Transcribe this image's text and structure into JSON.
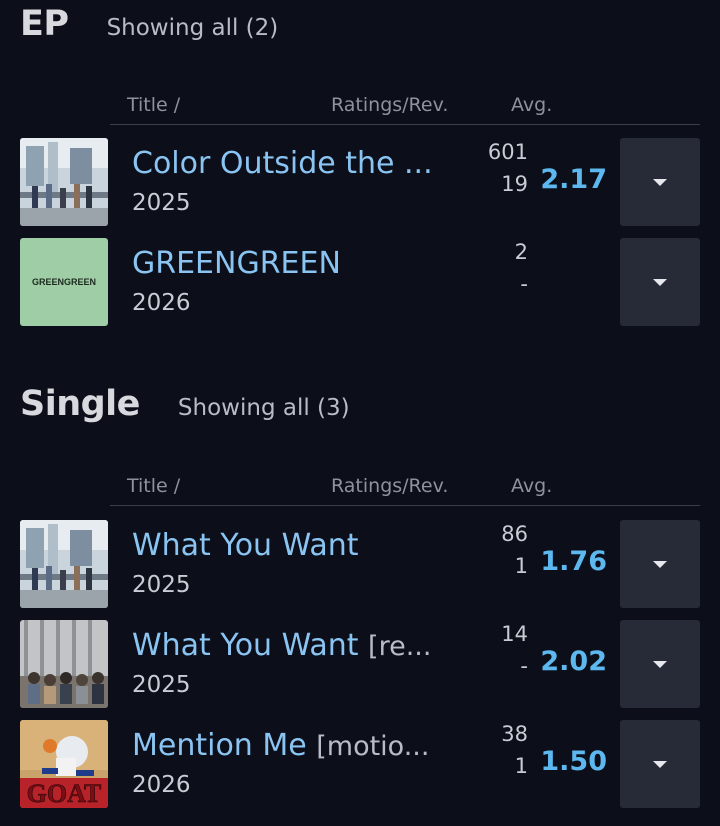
{
  "sections": [
    {
      "title": "EP",
      "count": "Showing all (2)",
      "columns": {
        "title": "Title /",
        "ratings": "Ratings/Rev.",
        "avg": "Avg."
      },
      "items": [
        {
          "title": "Color Outside the ...",
          "extra": "",
          "year": "2025",
          "ratings": "601",
          "reviews": "19",
          "avg": "2.17"
        },
        {
          "title": "GREENGREEN",
          "extra": "",
          "year": "2026",
          "ratings": "2",
          "reviews": "-",
          "avg": "",
          "cover_text": "GREENGREEN"
        }
      ]
    },
    {
      "title": "Single",
      "count": "Showing all (3)",
      "columns": {
        "title": "Title /",
        "ratings": "Ratings/Rev.",
        "avg": "Avg."
      },
      "items": [
        {
          "title": "What You Want",
          "extra": "",
          "year": "2025",
          "ratings": "86",
          "reviews": "1",
          "avg": "1.76"
        },
        {
          "title": "What You Want ",
          "extra": "[re...",
          "year": "2025",
          "ratings": "14",
          "reviews": "-",
          "avg": "2.02"
        },
        {
          "title": "Mention Me ",
          "extra": "[motio...",
          "year": "2026",
          "ratings": "38",
          "reviews": "1",
          "avg": "1.50",
          "cover_text": "GOAT"
        }
      ]
    }
  ],
  "colors": {
    "accent": "#5cb8ee",
    "title_link": "#8ac4f2",
    "background": "#0c0f19",
    "button": "#272b37"
  },
  "icons": {
    "menu": "chevron-down-icon"
  }
}
